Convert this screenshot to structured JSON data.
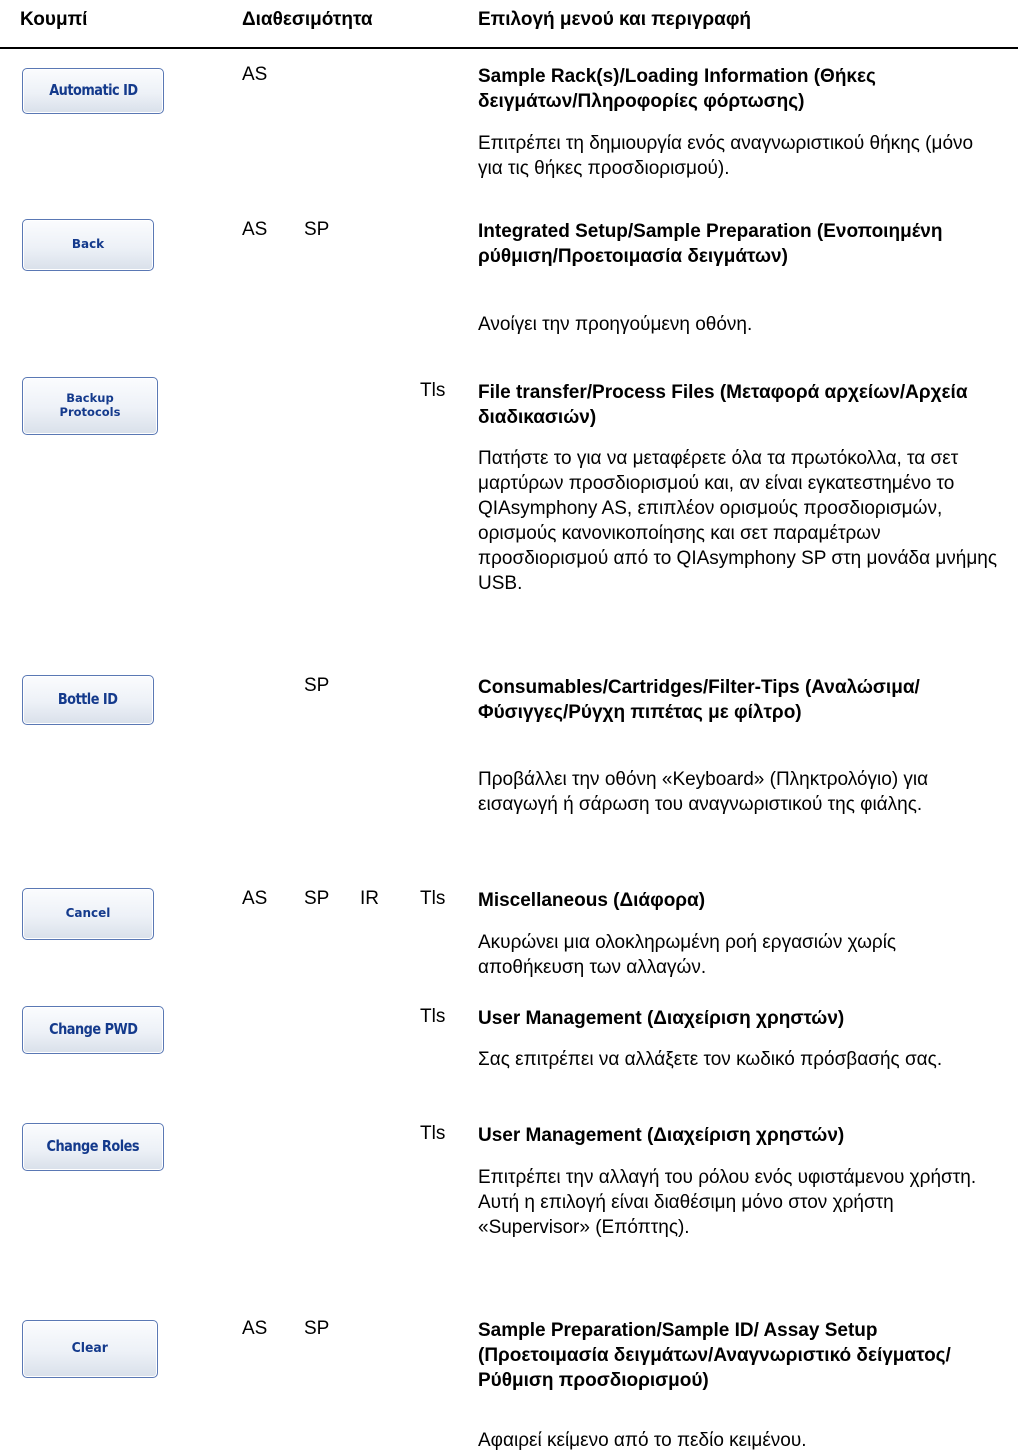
{
  "header": {
    "col_button": "Κουμπί",
    "col_availability": "Διαθεσιμότητα",
    "col_menu": "Επιλογή μενού και περιγραφή"
  },
  "rows": [
    {
      "button": "Automatic ID",
      "as": "AS",
      "sp": "",
      "ir": "",
      "tls": "",
      "title": "Sample Rack(s)/Loading Information (Θήκες δειγμάτων/Πληροφορίες φόρτωσης)",
      "description": "Επιτρέπει τη δημιουργία ενός αναγνωριστικού θήκης (μόνο για τις θήκες προσδιορισμού)."
    },
    {
      "button": "Back",
      "as": "AS",
      "sp": "SP",
      "ir": "",
      "tls": "",
      "title": "Integrated Setup/Sample Preparation (Ενοποιημένη ρύθμιση/Προετοιμασία δειγμάτων)",
      "description": "Ανοίγει την προηγούμενη οθόνη."
    },
    {
      "button": "Backup Protocols",
      "as": "",
      "sp": "",
      "ir": "",
      "tls": "Tls",
      "title": "File transfer/Process Files (Μεταφορά αρχείων/Αρχεία διαδικασιών)",
      "description": "Πατήστε το για να μεταφέρετε όλα τα πρωτόκολλα, τα σετ μαρτύρων προσδιορισμού και, αν είναι εγκατεστημένο το QIAsymphony AS, επιπλέον ορισμούς προσδιορισμών, ορισμούς κανονικοποίησης και σετ παραμέτρων προσδιορισμού από το QIAsymphony SP στη μονάδα μνήμης USB."
    },
    {
      "button": "Bottle ID",
      "as": "",
      "sp": "SP",
      "ir": "",
      "tls": "",
      "title": "Consumables/Cartridges/Filter-Tips (Αναλώσιμα/Φύσιγγες/Ρύγχη πιπέτας με φίλτρο)",
      "description": "Προβάλλει την οθόνη «Keyboard» (Πληκτρολόγιο) για εισαγωγή ή σάρωση του αναγνωριστικού της φιάλης."
    },
    {
      "button": "Cancel",
      "as": "AS",
      "sp": "SP",
      "ir": "IR",
      "tls": "Tls",
      "title": "Miscellaneous (Διάφορα)",
      "description": "Ακυρώνει μια ολοκληρωμένη ροή εργασιών χωρίς αποθήκευση των αλλαγών."
    },
    {
      "button": "Change PWD",
      "as": "",
      "sp": "",
      "ir": "",
      "tls": "Tls",
      "title": "User Management (Διαχείριση χρηστών)",
      "description": "Σας επιτρέπει να αλλάξετε τον κωδικό πρόσβασής σας."
    },
    {
      "button": "Change Roles",
      "as": "",
      "sp": "",
      "ir": "",
      "tls": "Tls",
      "title": "User Management (Διαχείριση χρηστών)",
      "description": "Επιτρέπει την αλλαγή του ρόλου ενός υφιστάμενου χρήστη. Αυτή η επιλογή είναι διαθέσιμη μόνο στον χρήστη «Supervisor» (Επόπτης)."
    },
    {
      "button": "Clear",
      "as": "AS",
      "sp": "SP",
      "ir": "",
      "tls": "",
      "title": "Sample Preparation/Sample ID/ Assay Setup (Προετοιμασία δειγμάτων/Αναγνωριστικό δείγματος/ Ρύθμιση προσδιορισμού)",
      "description": "Αφαιρεί κείμενο από το πεδίο κειμένου."
    }
  ]
}
